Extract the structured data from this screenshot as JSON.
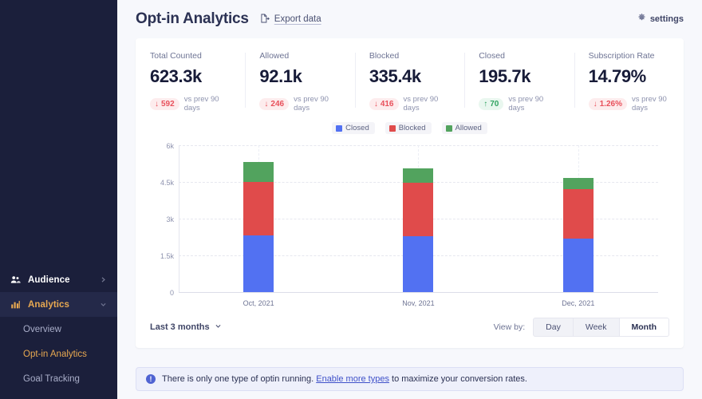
{
  "sidebar": {
    "items": [
      {
        "label": "Audience",
        "icon": "users-icon",
        "chevron": "chevron-right-icon",
        "active": false
      },
      {
        "label": "Analytics",
        "icon": "bar-chart-icon",
        "chevron": "chevron-down-icon",
        "active": true
      }
    ],
    "subitems": [
      {
        "label": "Overview",
        "active": false
      },
      {
        "label": "Opt-in Analytics",
        "active": true
      },
      {
        "label": "Goal Tracking",
        "active": false
      }
    ]
  },
  "header": {
    "title": "Opt-in Analytics",
    "export_label": "Export data",
    "export_icon": "export-document-icon",
    "settings_label": "settings",
    "settings_icon": "gear-icon"
  },
  "kpis": [
    {
      "label": "Total Counted",
      "value": "623.3k",
      "delta": "592",
      "direction": "down",
      "note": "vs prev 90 days"
    },
    {
      "label": "Allowed",
      "value": "92.1k",
      "delta": "246",
      "direction": "down",
      "note": "vs prev 90 days"
    },
    {
      "label": "Blocked",
      "value": "335.4k",
      "delta": "416",
      "direction": "down",
      "note": "vs prev 90 days"
    },
    {
      "label": "Closed",
      "value": "195.7k",
      "delta": "70",
      "direction": "up",
      "note": "vs prev 90 days"
    },
    {
      "label": "Subscription Rate",
      "value": "14.79%",
      "delta": "1.26%",
      "direction": "down",
      "note": "vs prev 90 days"
    }
  ],
  "chart_data": {
    "type": "bar",
    "stacked": true,
    "title": "",
    "xlabel": "",
    "ylabel": "",
    "categories": [
      "Oct, 2021",
      "Nov, 2021",
      "Dec, 2021"
    ],
    "series": [
      {
        "name": "Closed",
        "color": "#5271f2",
        "values": [
          2330,
          2280,
          2200
        ]
      },
      {
        "name": "Blocked",
        "color": "#e04b4b",
        "values": [
          2170,
          2200,
          2000
        ]
      },
      {
        "name": "Allowed",
        "color": "#52a35e",
        "values": [
          800,
          580,
          460
        ]
      }
    ],
    "totals": [
      5300,
      5060,
      4660
    ],
    "ylim": [
      0,
      6000
    ],
    "yticks": [
      0,
      1500,
      3000,
      4500,
      6000
    ],
    "ytick_labels": [
      "0",
      "1.5k",
      "3k",
      "4.5k",
      "6k"
    ],
    "grid": true,
    "legend_position": "top-center"
  },
  "controls": {
    "range_label": "Last 3 months",
    "range_chevron": "chevron-down-icon",
    "viewby_label": "View by:",
    "viewby_options": [
      "Day",
      "Week",
      "Month"
    ],
    "viewby_selected": "Month"
  },
  "banner": {
    "icon": "info-icon",
    "icon_glyph": "!",
    "text_before": "There is only one type of optin running. ",
    "link_text": "Enable more types",
    "text_after": " to maximize your conversion rates."
  }
}
